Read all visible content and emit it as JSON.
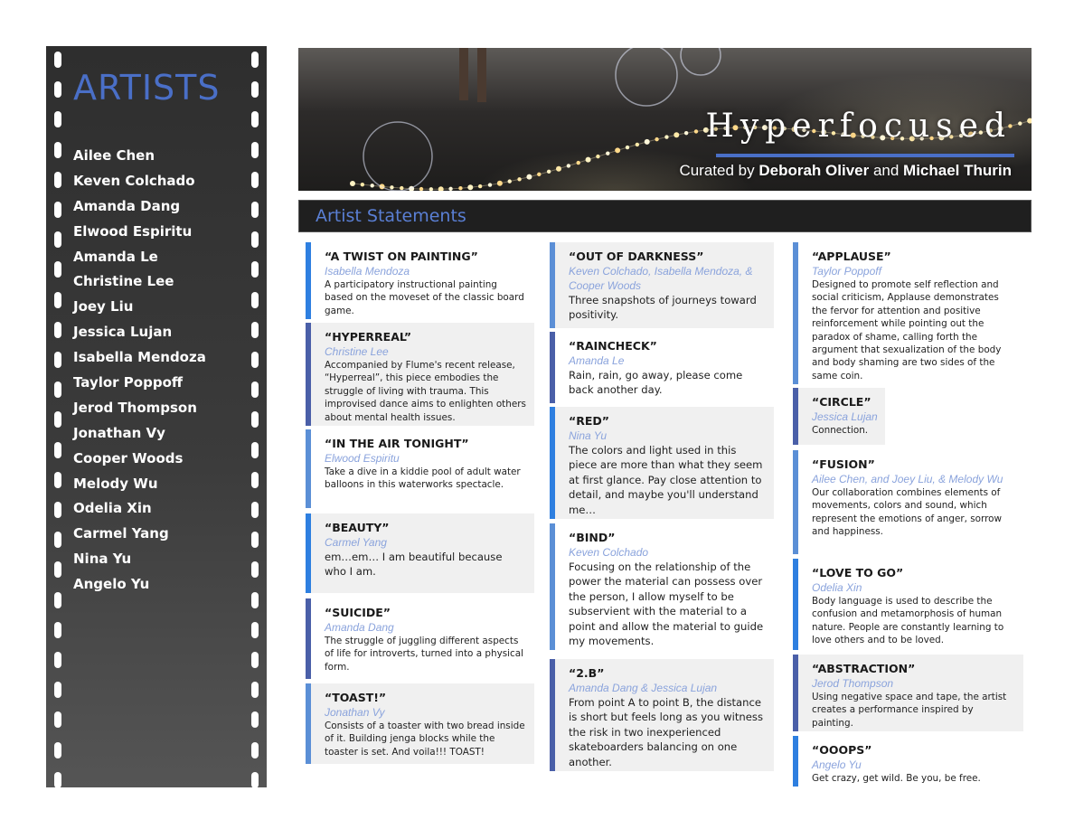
{
  "sidebar": {
    "title": "ARTISTS",
    "artists": [
      "Ailee Chen",
      "Keven Colchado",
      "Amanda Dang",
      "Elwood Espiritu",
      "Amanda Le",
      "Christine Lee",
      "Joey Liu",
      "Jessica Lujan",
      "Isabella Mendoza",
      "Taylor Poppoff",
      "Jerod Thompson",
      "Jonathan Vy",
      "Cooper Woods",
      "Melody Wu",
      "Odelia Xin",
      "Carmel Yang",
      "Nina Yu",
      "Angelo Yu"
    ]
  },
  "banner": {
    "title": "Hyperfocused",
    "credit_prefix": "Curated by ",
    "curator1": "Deborah Oliver",
    "credit_joiner": " and ",
    "curator2": "Michael Thurin"
  },
  "section": {
    "title": "Artist Statements"
  },
  "colors": {
    "accent": "#4a6fc7",
    "bar_dark": "#4a5fa8",
    "bar_mid": "#5b8fd6",
    "bar_bright": "#2e7fe0",
    "artist_link": "#8aa3dc"
  },
  "columns": [
    {
      "cards": [
        {
          "title": "“A TWIST ON PAINTING”",
          "by": "Isabella Mendoza",
          "desc": "A participatory instructional painting based on the moveset of the classic board game."
        },
        {
          "title": "“HYPERREAL”",
          "by": "Christine Lee",
          "desc": "Accompanied by Flume's recent release, “Hyperreal”, this piece embodies the struggle of living with trauma. This improvised dance aims to enlighten others about mental health issues."
        },
        {
          "title": "“IN THE AIR TONIGHT”",
          "by": "Elwood Espiritu",
          "desc": "Take a dive in a kiddie pool of adult water balloons in this waterworks spectacle."
        },
        {
          "title": "“BEAUTY”",
          "by": "Carmel Yang",
          "desc": "em…em… I am beautiful because who I am."
        },
        {
          "title": "“SUICIDE”",
          "by": "Amanda Dang",
          "desc": "The struggle of juggling different aspects of life for introverts, turned into a physical form."
        },
        {
          "title": "“TOAST!”",
          "by": "Jonathan Vy",
          "desc": "Consists of a toaster with two bread inside of it. Building jenga blocks while the toaster is set. And voila!!! TOAST!"
        }
      ]
    },
    {
      "cards": [
        {
          "title": "“OUT OF DARKNESS”",
          "by": "Keven Colchado, Isabella Mendoza, & Cooper Woods",
          "desc": "Three snapshots of journeys toward positivity."
        },
        {
          "title": "“RAINCHECK”",
          "by": "Amanda Le",
          "desc": "Rain, rain, go away, please come back another day."
        },
        {
          "title": "“RED”",
          "by": "Nina Yu",
          "desc": "The colors and light used in this piece are more than what they seem at first glance. Pay close attention to detail, and maybe you'll understand me…"
        },
        {
          "title": "“BIND”",
          "by": "Keven Colchado",
          "desc": "Focusing on the relationship of the power the material can possess over the person, I allow myself to be subservient with the material to a point and allow the material to guide my movements."
        },
        {
          "title": "“2.B”",
          "by": "Amanda Dang & Jessica Lujan",
          "desc": "From point A to point B, the distance is short but feels long as you witness the risk in two inexperienced skateboarders balancing on one another."
        }
      ]
    },
    {
      "cards": [
        {
          "title": "“APPLAUSE”",
          "by": "Taylor Poppoff",
          "desc": "Designed to promote self reflection and social criticism, Applause demonstrates the fervor for attention and positive reinforcement while pointing out the paradox of shame, calling forth the argument that sexualization of the body and body shaming are two sides of the same coin."
        },
        {
          "title": "“CIRCLE”",
          "by": "Jessica Lujan",
          "desc": "Connection."
        },
        {
          "title": "“FUSION”",
          "by": "Ailee Chen, and Joey Liu, & Melody Wu",
          "desc": "Our collaboration combines elements of movements, colors and sound, which represent the emotions of anger, sorrow and happiness."
        },
        {
          "title": "“LOVE TO GO”",
          "by": "Odelia Xin",
          "desc": "Body language is used to describe the confusion and metamorphosis of human nature. People are constantly learning to love others and to be loved."
        },
        {
          "title": "“ABSTRACTION”",
          "by": "Jerod Thompson",
          "desc": "Using negative space and tape, the artist creates a performance inspired by painting."
        },
        {
          "title": "“OOOPS”",
          "by": "Angelo Yu",
          "desc": "Get crazy, get wild. Be you, be free."
        }
      ]
    }
  ]
}
